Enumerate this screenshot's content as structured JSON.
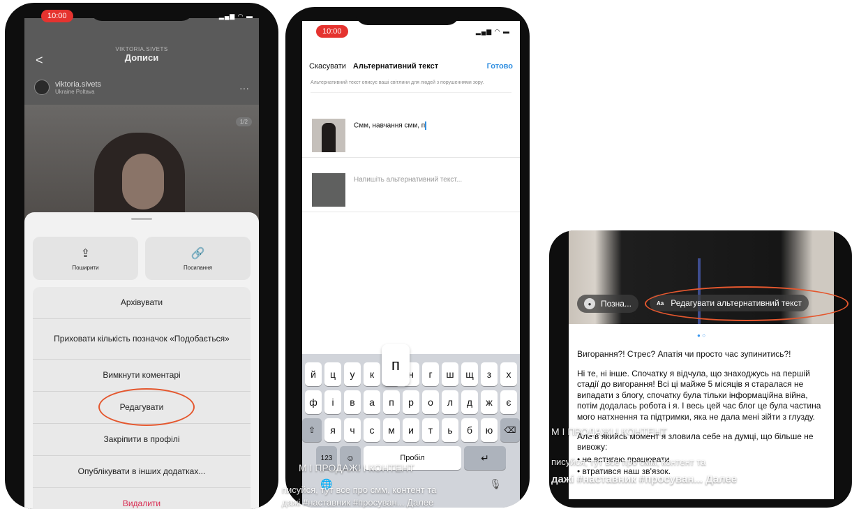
{
  "phone1": {
    "status_time": "10:00",
    "username_small": "VIKTORIA.SIVETS",
    "header_title": "Дописи",
    "user_name": "viktoria.sivets",
    "user_location": "Ukraine Poltava",
    "more_glyph": "···",
    "back_glyph": "<",
    "image_badge": "1/2",
    "share_label": "Поширити",
    "link_label": "Посилання",
    "menu": [
      "Архівувати",
      "Приховати кількість позначок «Подобається»",
      "Вимкнути коментарі",
      "Редагувати",
      "Закріпити в профілі",
      "Опублікувати в інших додатках...",
      "Видалити"
    ]
  },
  "phone2": {
    "status_time": "10:00",
    "cancel": "Скасувати",
    "title": "Альтернативний текст",
    "done": "Готово",
    "description": "Альтернативний текст описує ваші світлини для людей з порушеннями зору.",
    "item1_text": "Смм, навчання смм, п",
    "item2_placeholder": "Напишіть альтернативний текст...",
    "key_popup": "п",
    "keys_row1": [
      "й",
      "ц",
      "у",
      "к",
      "е",
      "н",
      "г",
      "ш",
      "щ",
      "з",
      "х"
    ],
    "keys_row2": [
      "ф",
      "і",
      "в",
      "а",
      "п",
      "р",
      "о",
      "л",
      "д",
      "ж",
      "є"
    ],
    "keys_row3": [
      "я",
      "ч",
      "с",
      "м",
      "и",
      "т",
      "ь",
      "б",
      "ю"
    ],
    "shift": "⇧",
    "backspace": "⌫",
    "num_key": "123",
    "emoji_key": "☺",
    "space": "Пробіл",
    "return_key": "↵",
    "globe": "🌐",
    "mic": "🎙",
    "overlay_line1": "М І ПРОДАЖІ І КОНТЕНТ",
    "overlay_line2": "писуйся, тут все про смм, контент та",
    "overlay_line3": "дажі #наставник #просуван... Далее"
  },
  "phone3": {
    "tag1": "Позна...",
    "tag2_prefix": "Aa",
    "tag2": "Редагувати альтернативний текст",
    "dots": "● ○",
    "heading": "Вигорання?! Стрес? Апатія чи просто час зупинитись?!",
    "para1": "Ні те, ні інше. Спочатку я відчула, що знаходжусь на першій стадії до вигорання! Всі ці майже 5 місяців я старалася не випадати з блогу, спочатку була тільки інформаційна війна, потім додалась робота і я. І весь цей час блог це була частина мого натхнення та підтримки, яка не дала мені зійти з глузду.",
    "para2": "Але в якийсь момент я зловила себе на думці, що більше не вивожу:",
    "para3": "• не встигаю працювати",
    "para4": "• втратився наш зв'язок.",
    "overlay_line1": "М І ПРОДАЖІ І КОНТЕНТ",
    "overlay_line2": "писуйся, тут все про смм, контент та",
    "overlay_line3": "дажі #наставник #просуван... Далее"
  },
  "colors": {
    "highlight": "#e4572e",
    "accent_blue": "#2f8ee0",
    "delete_red": "#d8294f",
    "status_red": "#e5332f"
  }
}
